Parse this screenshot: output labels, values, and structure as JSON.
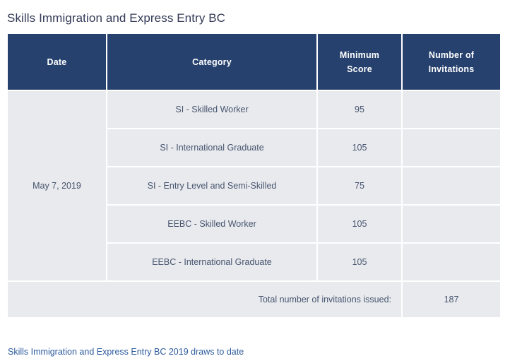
{
  "page": {
    "title": "Skills Immigration and Express Entry BC"
  },
  "colors": {
    "header_background": "#26416e",
    "header_text": "#ffffff",
    "cell_background": "#e8eaee",
    "cell_text": "#48556e",
    "title_text": "#333a56",
    "link_text": "#2d5b9e",
    "grid_gap": "#ffffff"
  },
  "table": {
    "columns": [
      {
        "key": "date",
        "label": "Date"
      },
      {
        "key": "category",
        "label": "Category"
      },
      {
        "key": "minimum_score",
        "label": "Minimum\nScore",
        "label_line1": "Minimum",
        "label_line2": "Score"
      },
      {
        "key": "number_of_invitations",
        "label": "Number of\nInvitations",
        "label_line1": "Number of",
        "label_line2": "Invitations"
      }
    ],
    "date_group": "May 7, 2019",
    "rows": [
      {
        "category": "SI - Skilled Worker",
        "minimum_score": "95",
        "number_of_invitations": ""
      },
      {
        "category": "SI - International Graduate",
        "minimum_score": "105",
        "number_of_invitations": ""
      },
      {
        "category": "SI - Entry Level and Semi-Skilled",
        "minimum_score": "75",
        "number_of_invitations": ""
      },
      {
        "category": "EEBC - Skilled Worker",
        "minimum_score": "105",
        "number_of_invitations": ""
      },
      {
        "category": "EEBC - International Graduate",
        "minimum_score": "105",
        "number_of_invitations": ""
      }
    ],
    "total": {
      "label": "Total number of invitations issued:",
      "value": "187"
    }
  },
  "footer": {
    "link_text": "Skills Immigration and Express Entry BC 2019 draws to date"
  }
}
